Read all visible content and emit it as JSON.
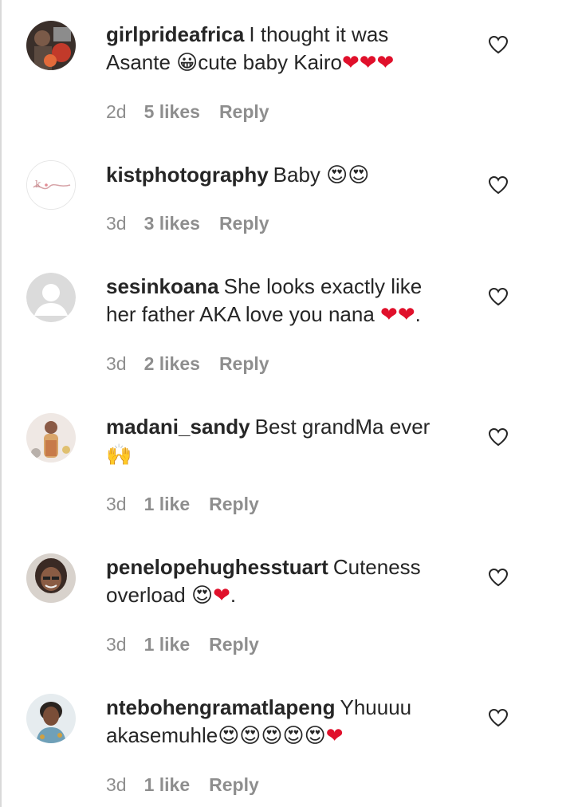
{
  "comments": [
    {
      "username": "girlprideafrica",
      "text_before": "I thought it was Asante ",
      "emoji_a": "😀",
      "text_mid": "cute baby Kairo",
      "hearts": "❤❤❤",
      "time": "2d",
      "likes": "5 likes",
      "reply": "Reply",
      "avatar": "photo-avatar-dark",
      "like_icon": "heart-outline-icon"
    },
    {
      "username": "kistphotography",
      "text_before": "Baby ",
      "emoji_a": "😍😍",
      "time": "3d",
      "likes": "3 likes",
      "reply": "Reply",
      "avatar": "logo-avatar-white",
      "like_icon": "heart-outline-icon"
    },
    {
      "username": "sesinkoana",
      "text_before": "She looks exactly like her father AKA love you nana ",
      "hearts": "❤❤",
      "text_after": ".",
      "time": "3d",
      "likes": "2 likes",
      "reply": "Reply",
      "avatar": "default-user-avatar",
      "like_icon": "heart-outline-icon"
    },
    {
      "username": "madani_sandy",
      "text_before": "Best grandMa ever ",
      "emoji_a": "🙌",
      "time": "3d",
      "likes": "1 like",
      "reply": "Reply",
      "avatar": "photo-avatar-light",
      "like_icon": "heart-outline-icon"
    },
    {
      "username": "penelopehughesstuart",
      "text_before": "Cuteness overload ",
      "emoji_a": "😍",
      "hearts": "❤",
      "text_after": ".",
      "time": "3d",
      "likes": "1 like",
      "reply": "Reply",
      "avatar": "photo-avatar-woman",
      "like_icon": "heart-outline-icon"
    },
    {
      "username": "ntebohengramatlapeng",
      "text_before": "Yhuuuu akasemuhle",
      "emoji_a": "😍😍😍😍😍",
      "hearts": "❤",
      "time": "3d",
      "likes": "1 like",
      "reply": "Reply",
      "avatar": "photo-avatar-woman-2",
      "like_icon": "heart-outline-icon"
    }
  ],
  "colors": {
    "text": "#262626",
    "meta": "#8e8e8e",
    "heart_red": "#e0102b"
  }
}
